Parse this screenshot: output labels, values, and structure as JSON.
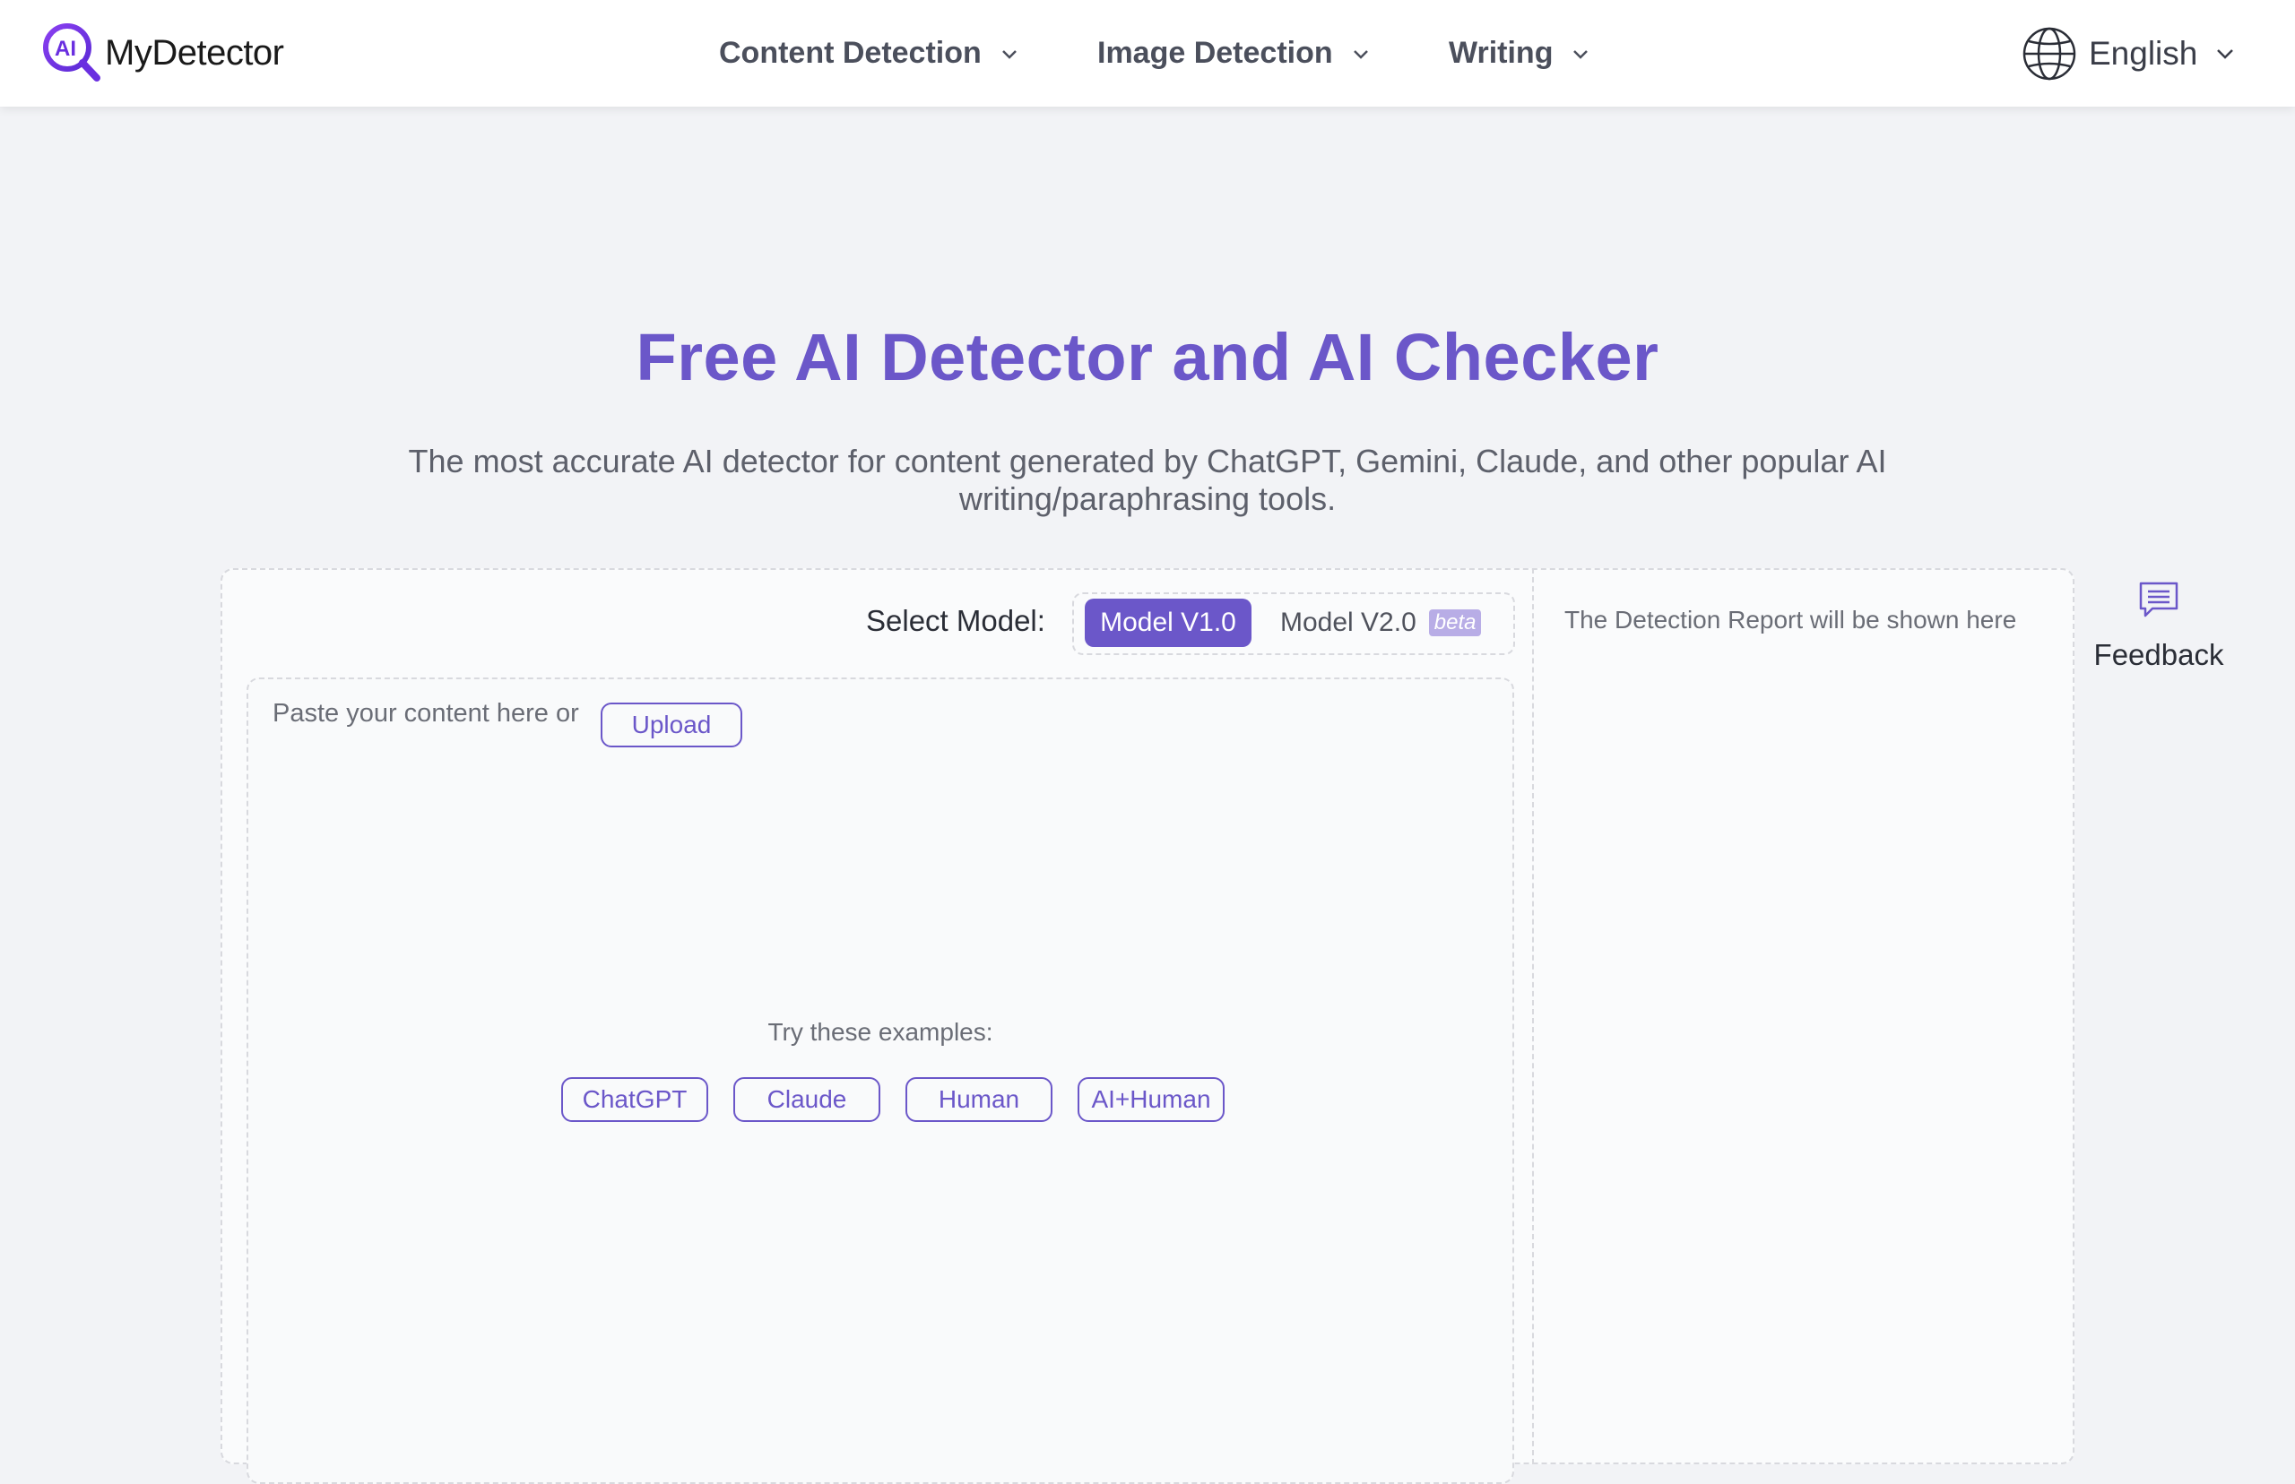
{
  "brand": {
    "name": "MyDetector",
    "logo_letters": "AI"
  },
  "nav": {
    "items": [
      {
        "label": "Content Detection"
      },
      {
        "label": "Image Detection"
      },
      {
        "label": "Writing"
      }
    ],
    "language": "English"
  },
  "hero": {
    "title": "Free AI Detector and AI Checker",
    "subtitle": "The most accurate AI detector for content generated by ChatGPT, Gemini, Claude, and other popular AI writing/paraphrasing tools."
  },
  "model_select": {
    "label": "Select Model:",
    "options": [
      {
        "label": "Model V1.0",
        "selected": true
      },
      {
        "label": "Model V2.0",
        "badge": "beta",
        "selected": false
      }
    ]
  },
  "editor": {
    "placeholder": "Paste your content here or",
    "upload_label": "Upload",
    "examples_label": "Try these examples:",
    "examples": [
      "ChatGPT",
      "Claude",
      "Human",
      "AI+Human"
    ]
  },
  "report": {
    "placeholder": "The Detection Report will be shown here"
  },
  "feedback": {
    "label": "Feedback"
  },
  "colors": {
    "accent": "#6b57c9",
    "background": "#f2f3f6",
    "badge": "#b8ade6"
  }
}
